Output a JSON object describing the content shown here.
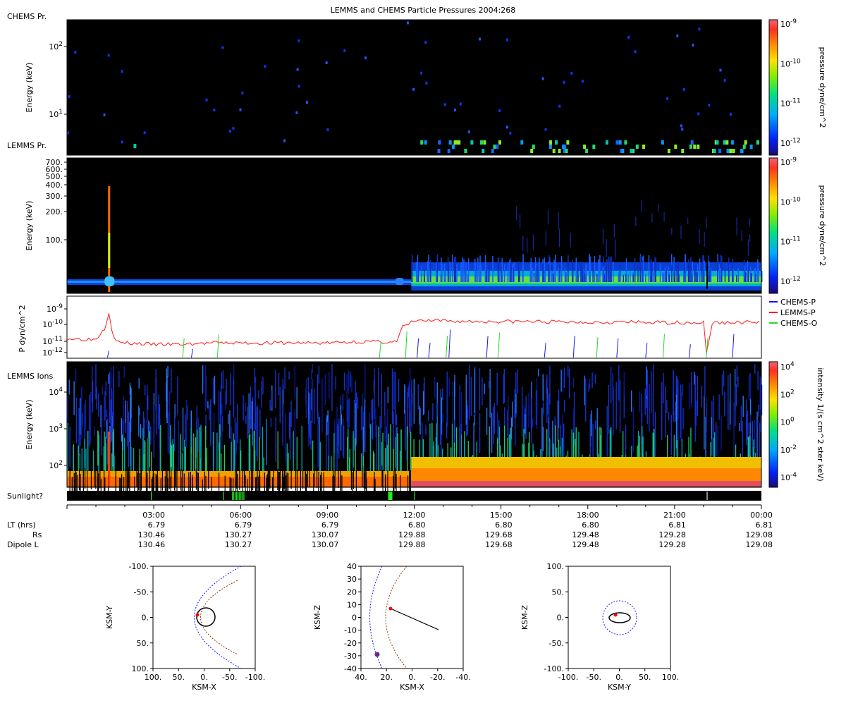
{
  "title": "LEMMS and CHEMS Particle Pressures  2004:268",
  "colors": {
    "chems_p": "#1414ff",
    "lemms_p": "#ff1a1a",
    "chems_o": "#22dd22",
    "sunlight": "#22ee22",
    "panel_bg": "#000000",
    "magnetopause": "#1a1aff",
    "bowshock": "#8b3a10",
    "orbit": "#000000",
    "spacecraft": "#ff0000"
  },
  "panels": {
    "chems": {
      "label": "CHEMS Pr.",
      "ylabel": "Energy (keV)",
      "yticks": [
        "10^2",
        "10^1"
      ],
      "colorbar_label": "pressure dyne/cm^2",
      "colorbar_ticks": [
        "10^-9",
        "10^-10",
        "10^-11",
        "10^-12"
      ]
    },
    "lemms_pr": {
      "label": "LEMMS Pr.",
      "ylabel": "Energy (keV)",
      "yticks": [
        "700.",
        "600.",
        "500.",
        "400.",
        "300.",
        "200.",
        "100."
      ],
      "colorbar_label": "pressure dyne/cm^2",
      "colorbar_ticks": [
        "10^-9",
        "10^-10",
        "10^-11",
        "10^-12"
      ]
    },
    "pressure": {
      "ylabel": "P dyn/cm^2",
      "yticks": [
        "10^-9",
        "10^-10",
        "10^-11",
        "10^-12"
      ]
    },
    "lemms_ions": {
      "label": "LEMMS Ions",
      "ylabel": "Energy (keV)",
      "yticks": [
        "10^4",
        "10^3",
        "10^2"
      ],
      "colorbar_label": "intensity 1/(s cm^2 ster keV)",
      "colorbar_ticks": [
        "10^4",
        "10^2",
        "10^0",
        "10^-2",
        "10^-4"
      ]
    },
    "sunlight": {
      "label": "Sunlight?"
    }
  },
  "legend": [
    "CHEMS-P",
    "LEMMS-P",
    "CHEMS-O"
  ],
  "ephemeris": {
    "row_labels": [
      "LT (hrs)",
      "Rs",
      "Dipole L"
    ],
    "times": [
      "03:00",
      "06:00",
      "09:00",
      "12:00",
      "15:00",
      "18:00",
      "21:00",
      "00:00"
    ],
    "lt": [
      "6.79",
      "6.79",
      "6.79",
      "6.80",
      "6.80",
      "6.80",
      "6.81",
      "6.81"
    ],
    "rs": [
      "130.46",
      "130.27",
      "130.07",
      "129.88",
      "129.68",
      "129.48",
      "129.28",
      "129.08"
    ],
    "dipole_l": [
      "130.46",
      "130.27",
      "130.07",
      "129.88",
      "129.68",
      "129.48",
      "129.28",
      "129.08"
    ]
  },
  "orbit_plots": [
    {
      "xlabel": "KSM-X",
      "ylabel": "KSM-Y",
      "xticks": [
        "100.",
        "50.",
        "0.",
        "-50.",
        "-100."
      ],
      "yticks": [
        "-100.",
        "-50.",
        "0.",
        "50.",
        "100."
      ]
    },
    {
      "xlabel": "KSM-X",
      "ylabel": "KSM-Z",
      "xticks": [
        "40.",
        "20.",
        "0.",
        "-20.",
        "-40."
      ],
      "yticks": [
        "40",
        "30",
        "20",
        "10",
        "0",
        "-10",
        "-20",
        "-30",
        "-40"
      ]
    },
    {
      "xlabel": "KSM-Y",
      "ylabel": "KSM-Z",
      "xticks": [
        "-100.",
        "-50.",
        "0.",
        "50.",
        "100."
      ],
      "yticks": [
        "100.",
        "50.",
        "0.",
        "-50.",
        "-100."
      ]
    }
  ],
  "chart_data": [
    {
      "type": "heatmap",
      "name": "CHEMS pressure spectrogram",
      "x_range_hours": [
        0,
        24
      ],
      "ylabel": "Energy (keV)",
      "y_scale": "log",
      "colorbar": "pressure dyne/cm^2",
      "z_range": [
        "10^-12",
        "10^-9"
      ]
    },
    {
      "type": "heatmap",
      "name": "LEMMS pressure spectrogram",
      "x_range_hours": [
        0,
        24
      ],
      "ylabel": "Energy (keV)",
      "yticks": [
        100,
        200,
        300,
        400,
        500,
        600,
        700
      ],
      "colorbar": "pressure dyne/cm^2",
      "z_range": [
        "10^-12",
        "10^-9"
      ]
    },
    {
      "type": "line",
      "ylabel": "P dyn/cm^2",
      "y_scale": "log",
      "x_range_hours": [
        0,
        24
      ],
      "series": [
        {
          "name": "LEMMS-P",
          "x": [
            0,
            0.5,
            1,
            1.3,
            1.45,
            1.55,
            1.7,
            2,
            3,
            4,
            5,
            6,
            7,
            8,
            9,
            10,
            11,
            11.4,
            11.6,
            11.8,
            12,
            13,
            14,
            15,
            16,
            17,
            18,
            19,
            20,
            21,
            22,
            22.1,
            22.3,
            23,
            24
          ],
          "y": [
            1e-11,
            9e-12,
            9e-12,
            5e-11,
            6e-10,
            4e-11,
            6e-12,
            5e-12,
            4e-12,
            4e-12,
            5e-12,
            5e-12,
            5e-12,
            5e-12,
            5e-12,
            6e-12,
            6e-12,
            6e-12,
            6e-11,
            9e-11,
            1.6e-10,
            1.5e-10,
            1.4e-10,
            1.4e-10,
            1.4e-10,
            1.3e-10,
            1.3e-10,
            1.3e-10,
            1.2e-10,
            1.2e-10,
            1.2e-10,
            1e-12,
            1.1e-10,
            1.2e-10,
            1.3e-10
          ]
        },
        {
          "name": "CHEMS-P",
          "x": [
            1.4,
            4.3,
            12.1,
            12.5,
            13.2,
            14.5,
            16.5,
            17.5,
            19,
            20,
            21.5,
            23
          ],
          "y": [
            1.5e-12,
            2e-12,
            1e-11,
            5e-12,
            4e-11,
            1.5e-11,
            5e-12,
            1.5e-11,
            1e-11,
            5e-12,
            4e-12,
            2e-11
          ]
        },
        {
          "name": "CHEMS-O",
          "x": [
            4,
            5.2,
            10.8,
            11.7,
            13.1,
            14.9,
            18.3,
            20.6,
            22.1
          ],
          "y": [
            1e-11,
            2e-11,
            6e-12,
            3e-11,
            1.5e-11,
            2.5e-11,
            1.2e-11,
            2e-11,
            1e-11
          ]
        }
      ]
    },
    {
      "type": "heatmap",
      "name": "LEMMS ion intensity spectrogram",
      "x_range_hours": [
        0,
        24
      ],
      "ylabel": "Energy (keV)",
      "y_scale": "log",
      "colorbar": "intensity 1/(s cm^2 ster keV)",
      "z_range": [
        "10^-4",
        "10^4"
      ]
    }
  ]
}
